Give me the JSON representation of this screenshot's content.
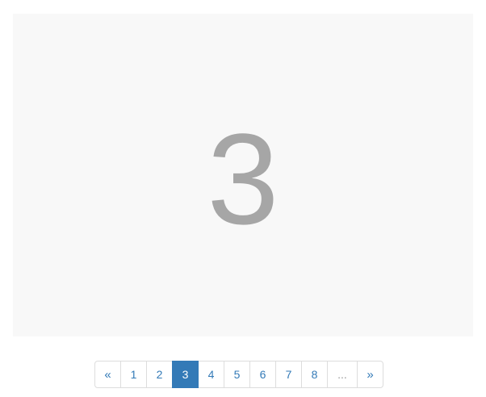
{
  "slide": {
    "current_label": "3"
  },
  "pagination": {
    "prev_label": "«",
    "next_label": "»",
    "pages": [
      "1",
      "2",
      "3",
      "4",
      "5",
      "6",
      "7",
      "8"
    ],
    "ellipsis_label": "...",
    "active_page": "3",
    "colors": {
      "accent": "#337ab7",
      "border": "#dddddd",
      "muted": "#999999"
    }
  }
}
